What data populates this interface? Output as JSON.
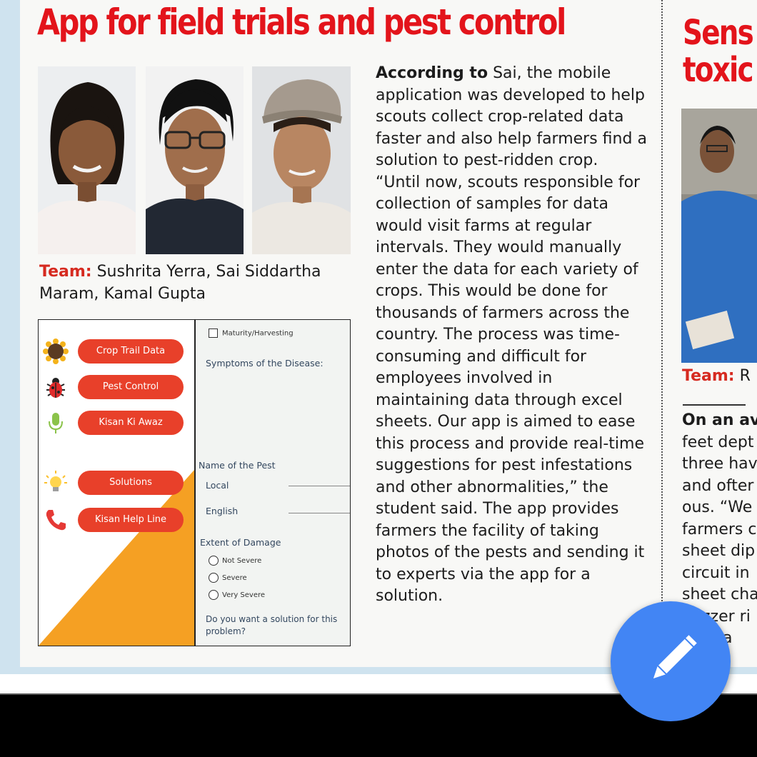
{
  "article": {
    "headline": "App for field trials and pest control",
    "team_label": "Team:",
    "team_names": "Sushrita Yerra, Sai Siddartha Maram, Kamal Gupta",
    "body_lead": "According to",
    "body_text": "Sai, the mobile application was developed to help scouts collect crop-related data faster and also help farmers find a solution to pest-ridden crop. “Until now, scouts responsible for collection of samples for data would visit farms at regular intervals. They would manually enter the data for each variety of crops. This would be done for thousands of farmers across the country. The process was time-consuming and difficult for employees involved in maintaining data through excel sheets. Our app is aimed to ease this process and provide real-time suggestions for pest infestations and other abnormalities,” the student said. The app provides farmers the facility of taking photos of the pests and sending it to experts via the app for a solution."
  },
  "app_screenshot": {
    "menu": [
      {
        "label": "Crop Trail Data",
        "icon": "sunflower-icon"
      },
      {
        "label": "Pest Control",
        "icon": "bug-icon"
      },
      {
        "label": "Kisan Ki Awaz",
        "icon": "microphone-icon"
      },
      {
        "label": "Solutions",
        "icon": "lightbulb-icon"
      },
      {
        "label": "Kisan Help Line",
        "icon": "phone-icon"
      }
    ],
    "form": {
      "checkbox_label": "Maturity/Harvesting",
      "symptoms_label": "Symptoms of the Disease:",
      "pest_name_label": "Name of the Pest",
      "local_label": "Local",
      "english_label": "English",
      "damage_label": "Extent of Damage",
      "damage_options": [
        "Not Severe",
        "Severe",
        "Very Severe"
      ],
      "question_line1": "Do you want a solution for this",
      "question_line2": "problem?"
    }
  },
  "next_article": {
    "headline_line1": "Sens",
    "headline_line2": "toxic",
    "team_label": "Team:",
    "team_partial": "R",
    "body_lines": [
      "On an av",
      "feet dept",
      "three hav",
      "and ofter",
      "ous. “We",
      "farmers c",
      "sheet dip",
      "circuit in",
      "sheet cha",
      "zzer ri",
      "in a"
    ]
  },
  "fab": {
    "icon": "pencil-icon"
  }
}
